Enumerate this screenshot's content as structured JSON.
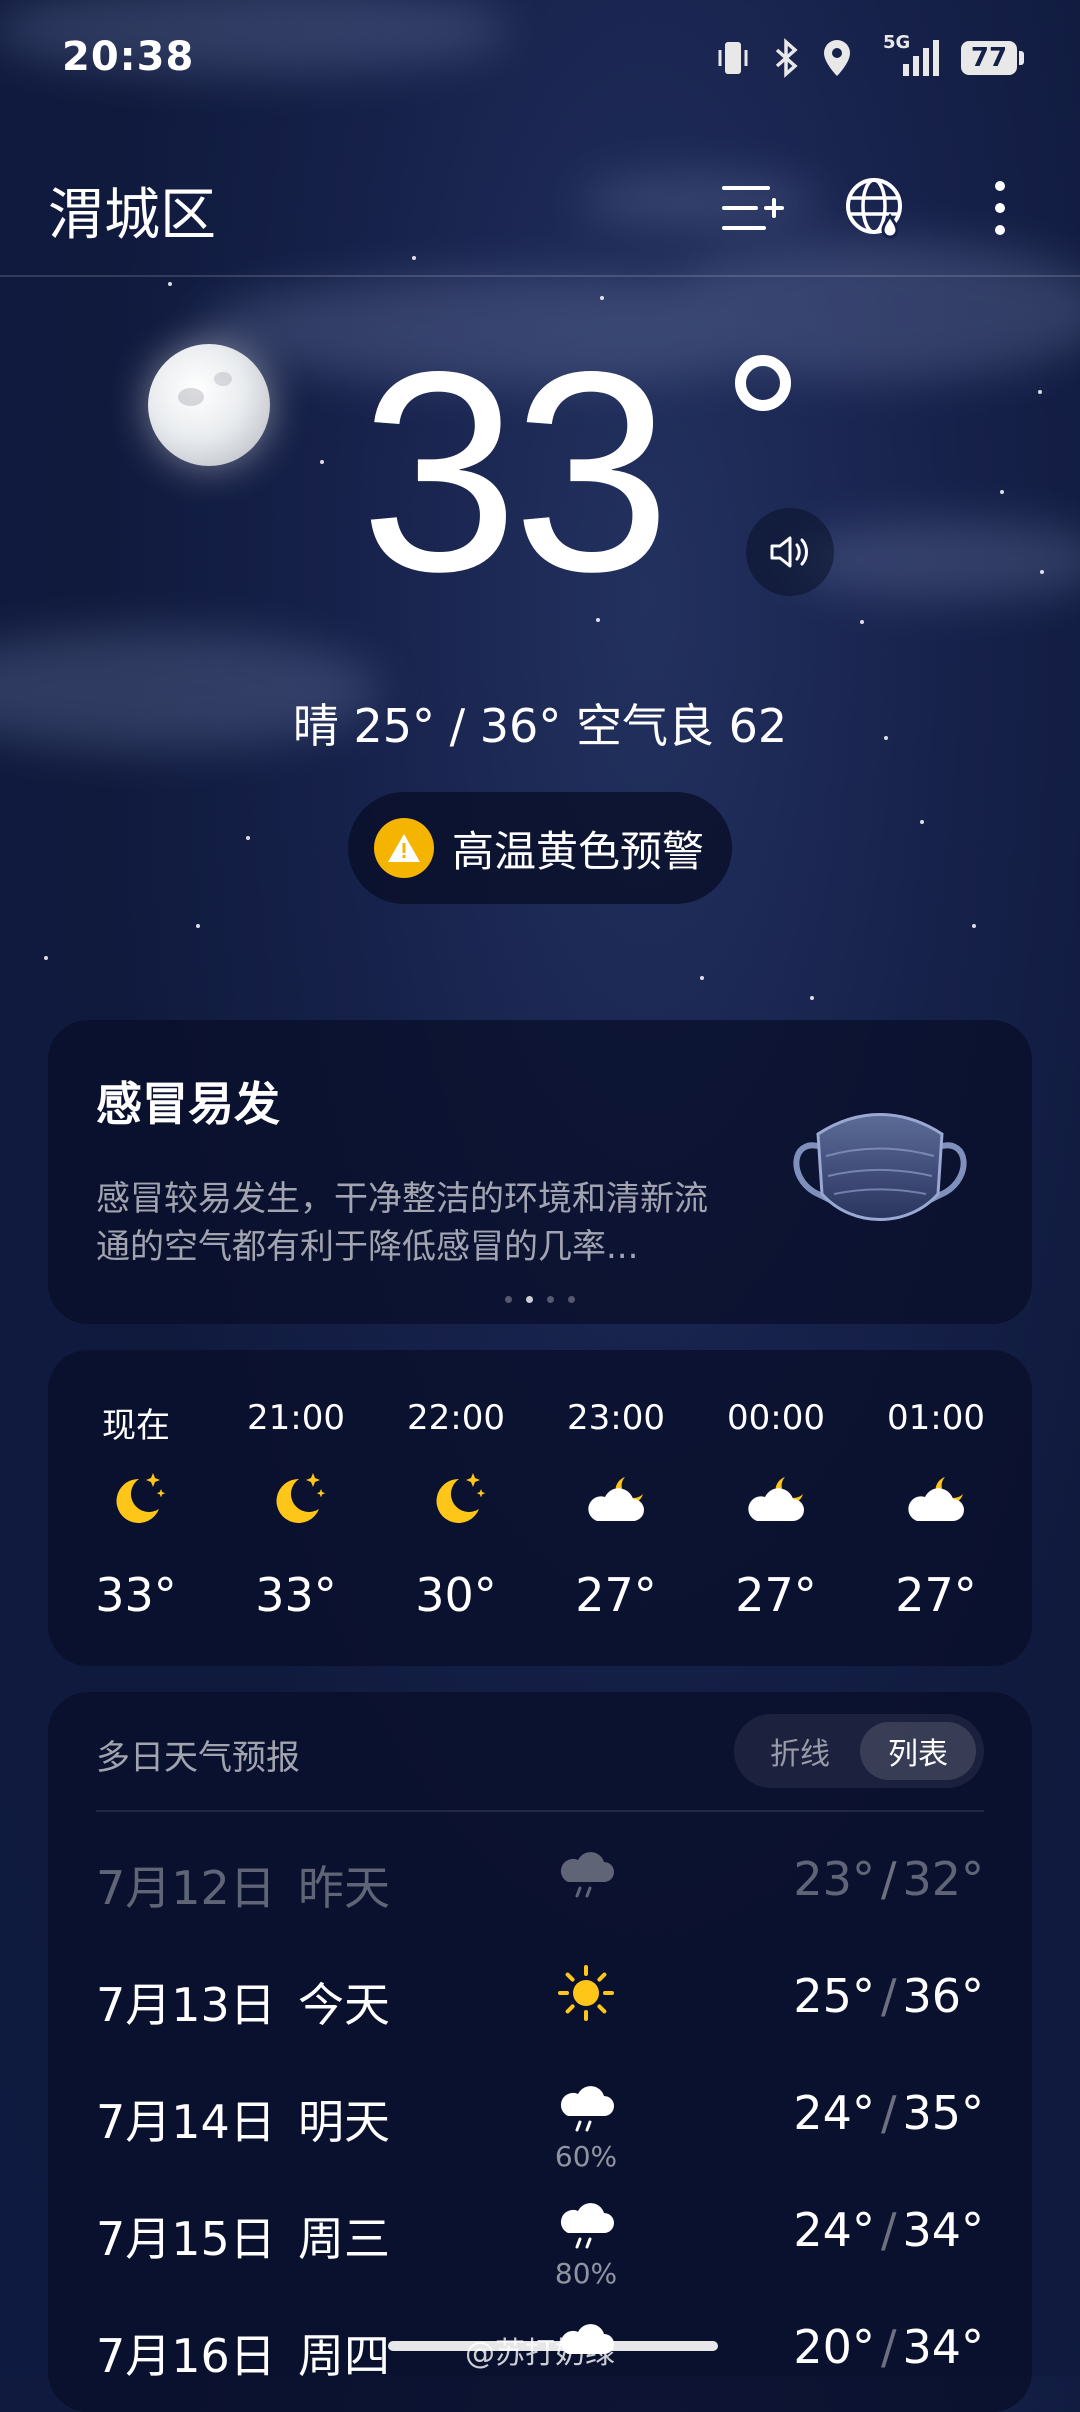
{
  "status_bar": {
    "time": "20:38",
    "network": "5G",
    "battery": "77"
  },
  "header": {
    "city": "渭城区",
    "icons": [
      "add-city-icon",
      "globe-weather-icon",
      "more-vert-icon"
    ]
  },
  "current": {
    "temperature": "33",
    "summary": "晴  25° / 36°  空气良 62",
    "alert": "高温黄色预警"
  },
  "tip_card": {
    "title": "感冒易发",
    "description": "感冒较易发生，干净整洁的环境和清新流通的空气都有利于降低感冒的几率...",
    "page_count": 4,
    "active_page": 1
  },
  "hourly": [
    {
      "time": "现在",
      "icon": "moon-stars-icon",
      "temp": "33°"
    },
    {
      "time": "21:00",
      "icon": "moon-stars-icon",
      "temp": "33°"
    },
    {
      "time": "22:00",
      "icon": "moon-stars-icon",
      "temp": "30°"
    },
    {
      "time": "23:00",
      "icon": "cloudy-night-icon",
      "temp": "27°"
    },
    {
      "time": "00:00",
      "icon": "cloudy-night-icon",
      "temp": "27°"
    },
    {
      "time": "01:00",
      "icon": "cloudy-night-icon",
      "temp": "27°"
    }
  ],
  "daily": {
    "title": "多日天气预报",
    "toggle": {
      "line": "折线",
      "list": "列表",
      "selected": "列表"
    },
    "days": [
      {
        "date": "7月12日",
        "label": "昨天",
        "icon": "rain-icon",
        "precip": "",
        "low": "23°",
        "high": "32°",
        "past": true
      },
      {
        "date": "7月13日",
        "label": "今天",
        "icon": "sun-icon",
        "precip": "",
        "low": "25°",
        "high": "36°"
      },
      {
        "date": "7月14日",
        "label": "明天",
        "icon": "rain-icon",
        "precip": "60%",
        "low": "24°",
        "high": "35°"
      },
      {
        "date": "7月15日",
        "label": "周三",
        "icon": "rain-icon",
        "precip": "80%",
        "low": "24°",
        "high": "34°"
      },
      {
        "date": "7月16日",
        "label": "周四",
        "icon": "cloud-icon",
        "precip": "",
        "low": "20°",
        "high": "34°"
      }
    ]
  },
  "watermark": "@苏打奶绿",
  "colors": {
    "accent": "#f5b400",
    "moon": "#ffc61a",
    "background": "#16214a"
  }
}
